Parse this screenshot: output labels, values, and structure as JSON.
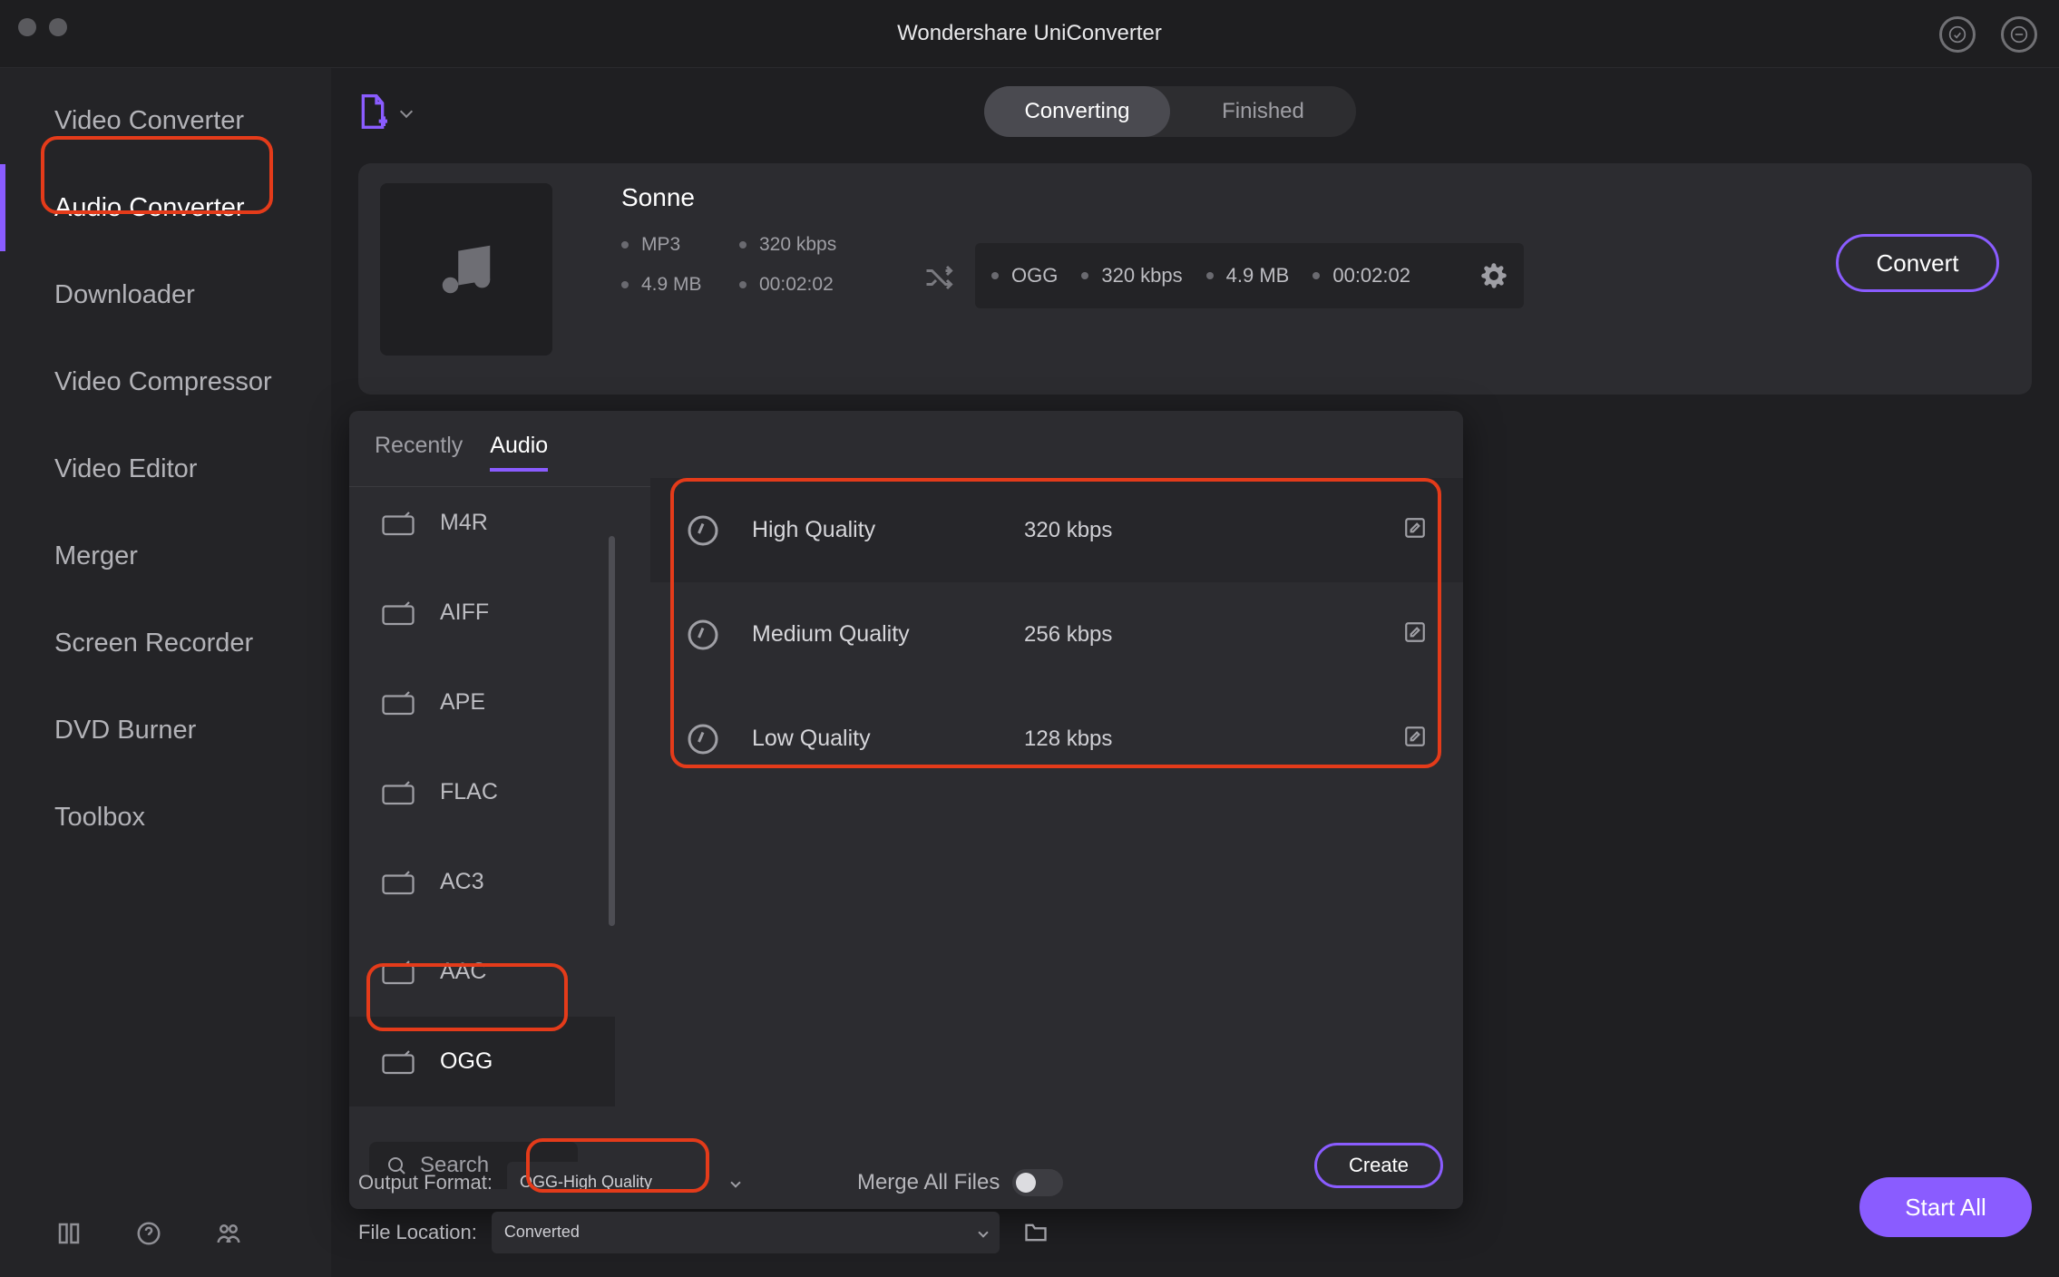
{
  "app_title": "Wondershare UniConverter",
  "sidebar": {
    "items": [
      {
        "label": "Video Converter"
      },
      {
        "label": "Audio Converter"
      },
      {
        "label": "Downloader"
      },
      {
        "label": "Video Compressor"
      },
      {
        "label": "Video Editor"
      },
      {
        "label": "Merger"
      },
      {
        "label": "Screen Recorder"
      },
      {
        "label": "DVD Burner"
      },
      {
        "label": "Toolbox"
      }
    ],
    "active_index": 1
  },
  "segmented": {
    "items": [
      "Converting",
      "Finished"
    ],
    "active_index": 0
  },
  "file": {
    "title": "Sonne",
    "src_format": "MP3",
    "src_bitrate": "320 kbps",
    "src_size": "4.9 MB",
    "src_duration": "00:02:02",
    "dst_format": "OGG",
    "dst_bitrate": "320 kbps",
    "dst_size": "4.9 MB",
    "dst_duration": "00:02:02"
  },
  "convert_label": "Convert",
  "popover": {
    "tabs": [
      "Recently",
      "Audio"
    ],
    "active_tab": 1,
    "formats": [
      "M4R",
      "AIFF",
      "APE",
      "FLAC",
      "AC3",
      "AAC",
      "OGG"
    ],
    "selected_index": 6,
    "qualities": [
      {
        "name": "High Quality",
        "rate": "320 kbps"
      },
      {
        "name": "Medium Quality",
        "rate": "256 kbps"
      },
      {
        "name": "Low Quality",
        "rate": "128 kbps"
      }
    ],
    "selected_quality": 0,
    "search_placeholder": "Search",
    "create_label": "Create"
  },
  "bottom": {
    "output_label": "Output Format:",
    "output_value": "OGG-High Quality",
    "merge_label": "Merge All Files",
    "location_label": "File Location:",
    "location_value": "Converted",
    "startall_label": "Start All"
  }
}
